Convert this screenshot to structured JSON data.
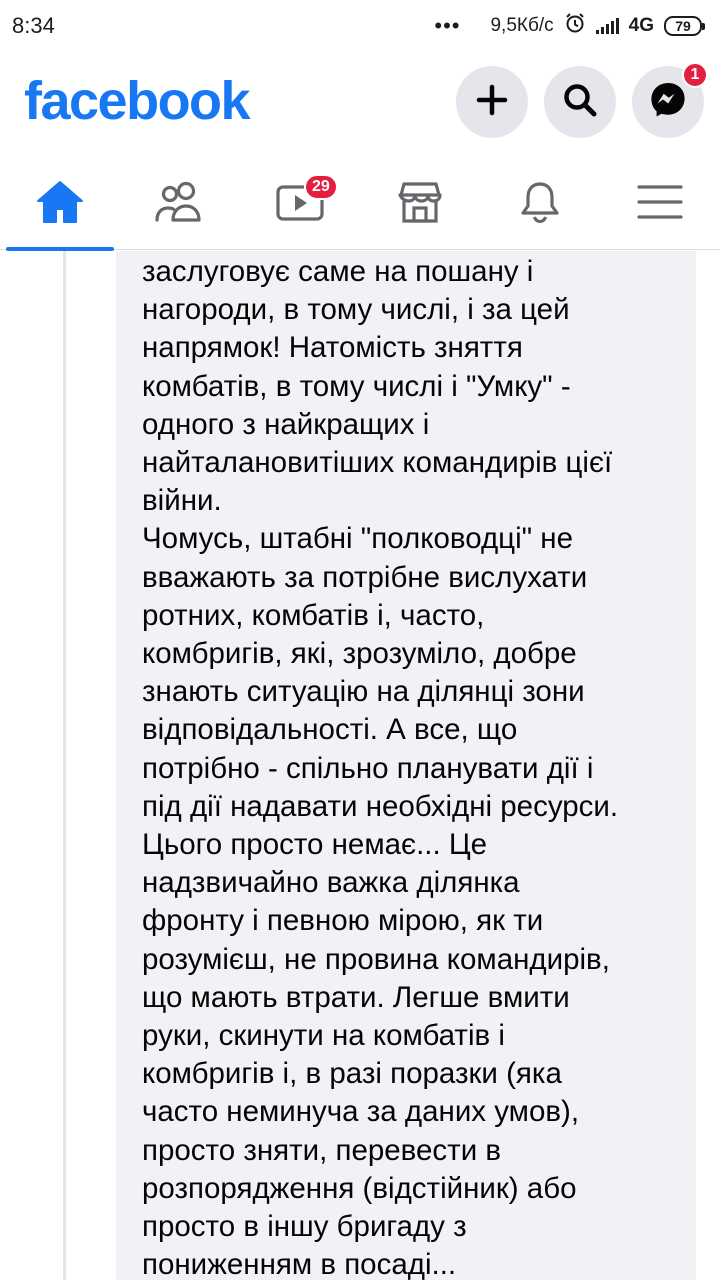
{
  "status_bar": {
    "time": "8:34",
    "dots": "•••",
    "speed": "9,5Кб/с",
    "network": "4G",
    "battery": "79"
  },
  "header": {
    "logo": "facebook",
    "messenger_badge": "1"
  },
  "tabs": {
    "watch_badge": "29"
  },
  "icons": [
    "plus-icon",
    "search-icon",
    "messenger-icon",
    "home-icon",
    "friends-icon",
    "watch-icon",
    "marketplace-icon",
    "bell-icon",
    "menu-icon"
  ],
  "colors": {
    "brand": "#1877f2",
    "badge": "#e41e3f",
    "bubble": "#f0f2f5"
  },
  "comment": {
    "text": "заслуговує саме на пошану і\nнагороди, в тому числі, і за цей\nнапрямок! Натомість зняття\nкомбатів, в тому числі і \"Умку\" -\nодного з найкращих і\nнайталановитіших командирів цієї\nвійни.\nЧомусь, штабні \"полководці\" не\nвважають за потрібне вислухати\nротних, комбатів і, часто,\nкомбригів, які, зрозуміло, добре\nзнають ситуацію на ділянці зони\nвідповідальності. А все, що\nпотрібно - спільно планувати дії і\nпід дії надавати необхідні ресурси.\nЦього просто немає... Це\nнадзвичайно важка ділянка\nфронту і певною мірою, як ти\nрозумієш, не провина командирів,\nщо мають втрати. Легше вмити\nруки, скинути на комбатів і\nкомбригів і, в разі поразки (яка\nчасто неминуча за даних умов),\nпросто зняти, перевести в\nрозпорядження (відстійник) або\nпросто в іншу бригаду з\nпониженням в посаді..."
  }
}
